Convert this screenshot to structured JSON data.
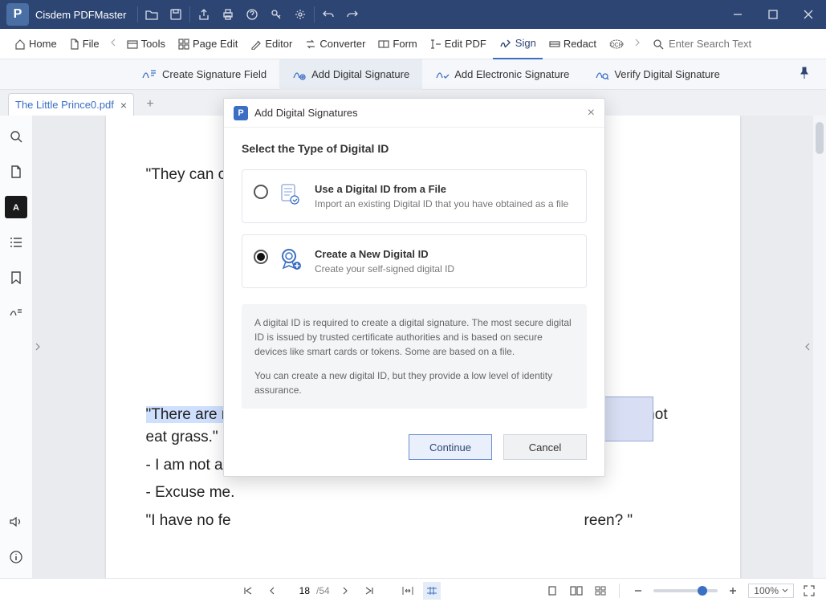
{
  "app": {
    "title": "Cisdem PDFMaster"
  },
  "toolbar": {
    "home": "Home",
    "file": "File",
    "tools": "Tools",
    "page_edit": "Page Edit",
    "editor": "Editor",
    "converter": "Converter",
    "form": "Form",
    "edit_pdf": "Edit PDF",
    "sign": "Sign",
    "redact": "Redact",
    "search_placeholder": "Enter Search Text"
  },
  "signbar": {
    "create_field": "Create Signature Field",
    "add_digital": "Add Digital Signature",
    "add_electronic": "Add Electronic Signature",
    "verify": "Verify Digital Signature"
  },
  "tabs": {
    "doc": "The Little Prince0.pdf"
  },
  "document": {
    "line1": "\"They can co",
    "line2_hl": "\"There are no",
    "line2_rest": "tigers do not",
    "line3": "eat grass.\"",
    "line4": "- I am not a g",
    "line5": "- Excuse me.",
    "line6_a": "\"I have no fe",
    "line6_b": "reen? \""
  },
  "statusbar": {
    "page": "18",
    "total": "/54",
    "zoom": "100%"
  },
  "dialog": {
    "title": "Add Digital Signatures",
    "heading": "Select the Type of Digital ID",
    "opt1_title": "Use a Digital ID from a File",
    "opt1_desc": "Import an existing Digital ID that you have obtained as a file",
    "opt2_title": "Create a New Digital ID",
    "opt2_desc": "Create your self-signed digital ID",
    "info1": "A digital ID is required to create a digital signature. The most secure digital ID is issued by trusted certificate authorities and is based on secure devices like smart cards or tokens. Some are based on a file.",
    "info2": "You can create a new digital ID, but they provide a low level of identity assurance.",
    "continue": "Continue",
    "cancel": "Cancel"
  }
}
